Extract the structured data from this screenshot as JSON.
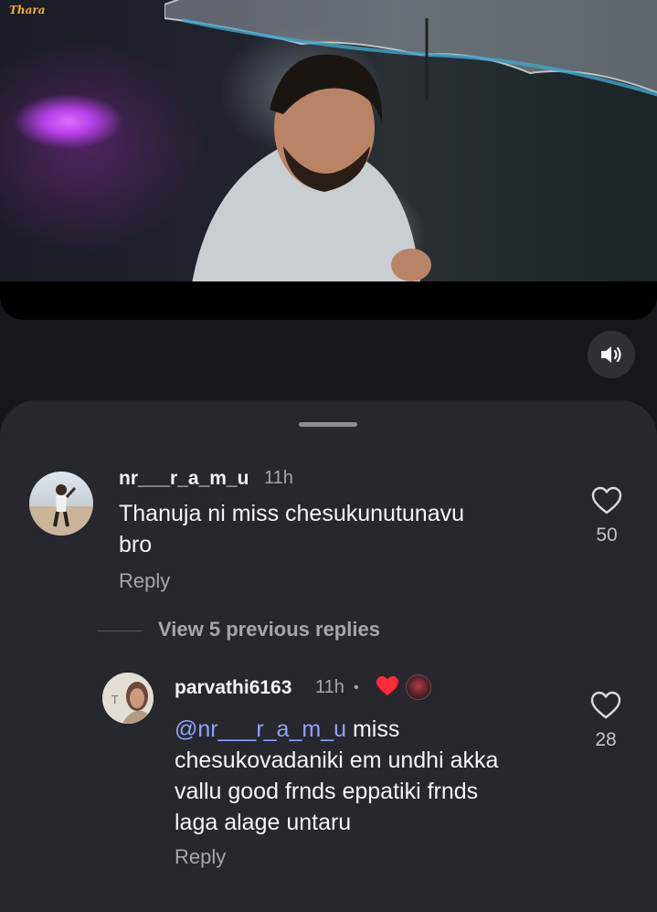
{
  "video": {
    "brand": "Thara"
  },
  "comments": [
    {
      "username": "nr___r_a_m_u",
      "time": "11h",
      "text": "Thanuja ni miss chesukunutunavu bro",
      "text_line1": "Thanuja ni miss chesukunutunavu",
      "text_line2": "bro",
      "reply_label": "Reply",
      "likes": "50"
    }
  ],
  "thread": {
    "view_replies_label": "View 5 previous replies"
  },
  "replies": [
    {
      "username": "parvathi6163",
      "time": "11h",
      "separator": "•",
      "mention": "@nr___r_a_m_u",
      "line1_rest": " miss",
      "line2": "chesukovadaniki em undhi akka",
      "line3": "vallu good frnds eppatiki frnds",
      "line4": "laga alage untaru",
      "reply_label": "Reply",
      "likes": "28"
    }
  ],
  "icons": {
    "sound": "speaker-icon",
    "like": "heart-outline-icon",
    "creator_liked": "heart-filled-icon"
  },
  "colors": {
    "background": "#16171b",
    "sheet": "#27282d",
    "mention": "#8ea2ff",
    "liked_heart": "#ff2a3a"
  }
}
